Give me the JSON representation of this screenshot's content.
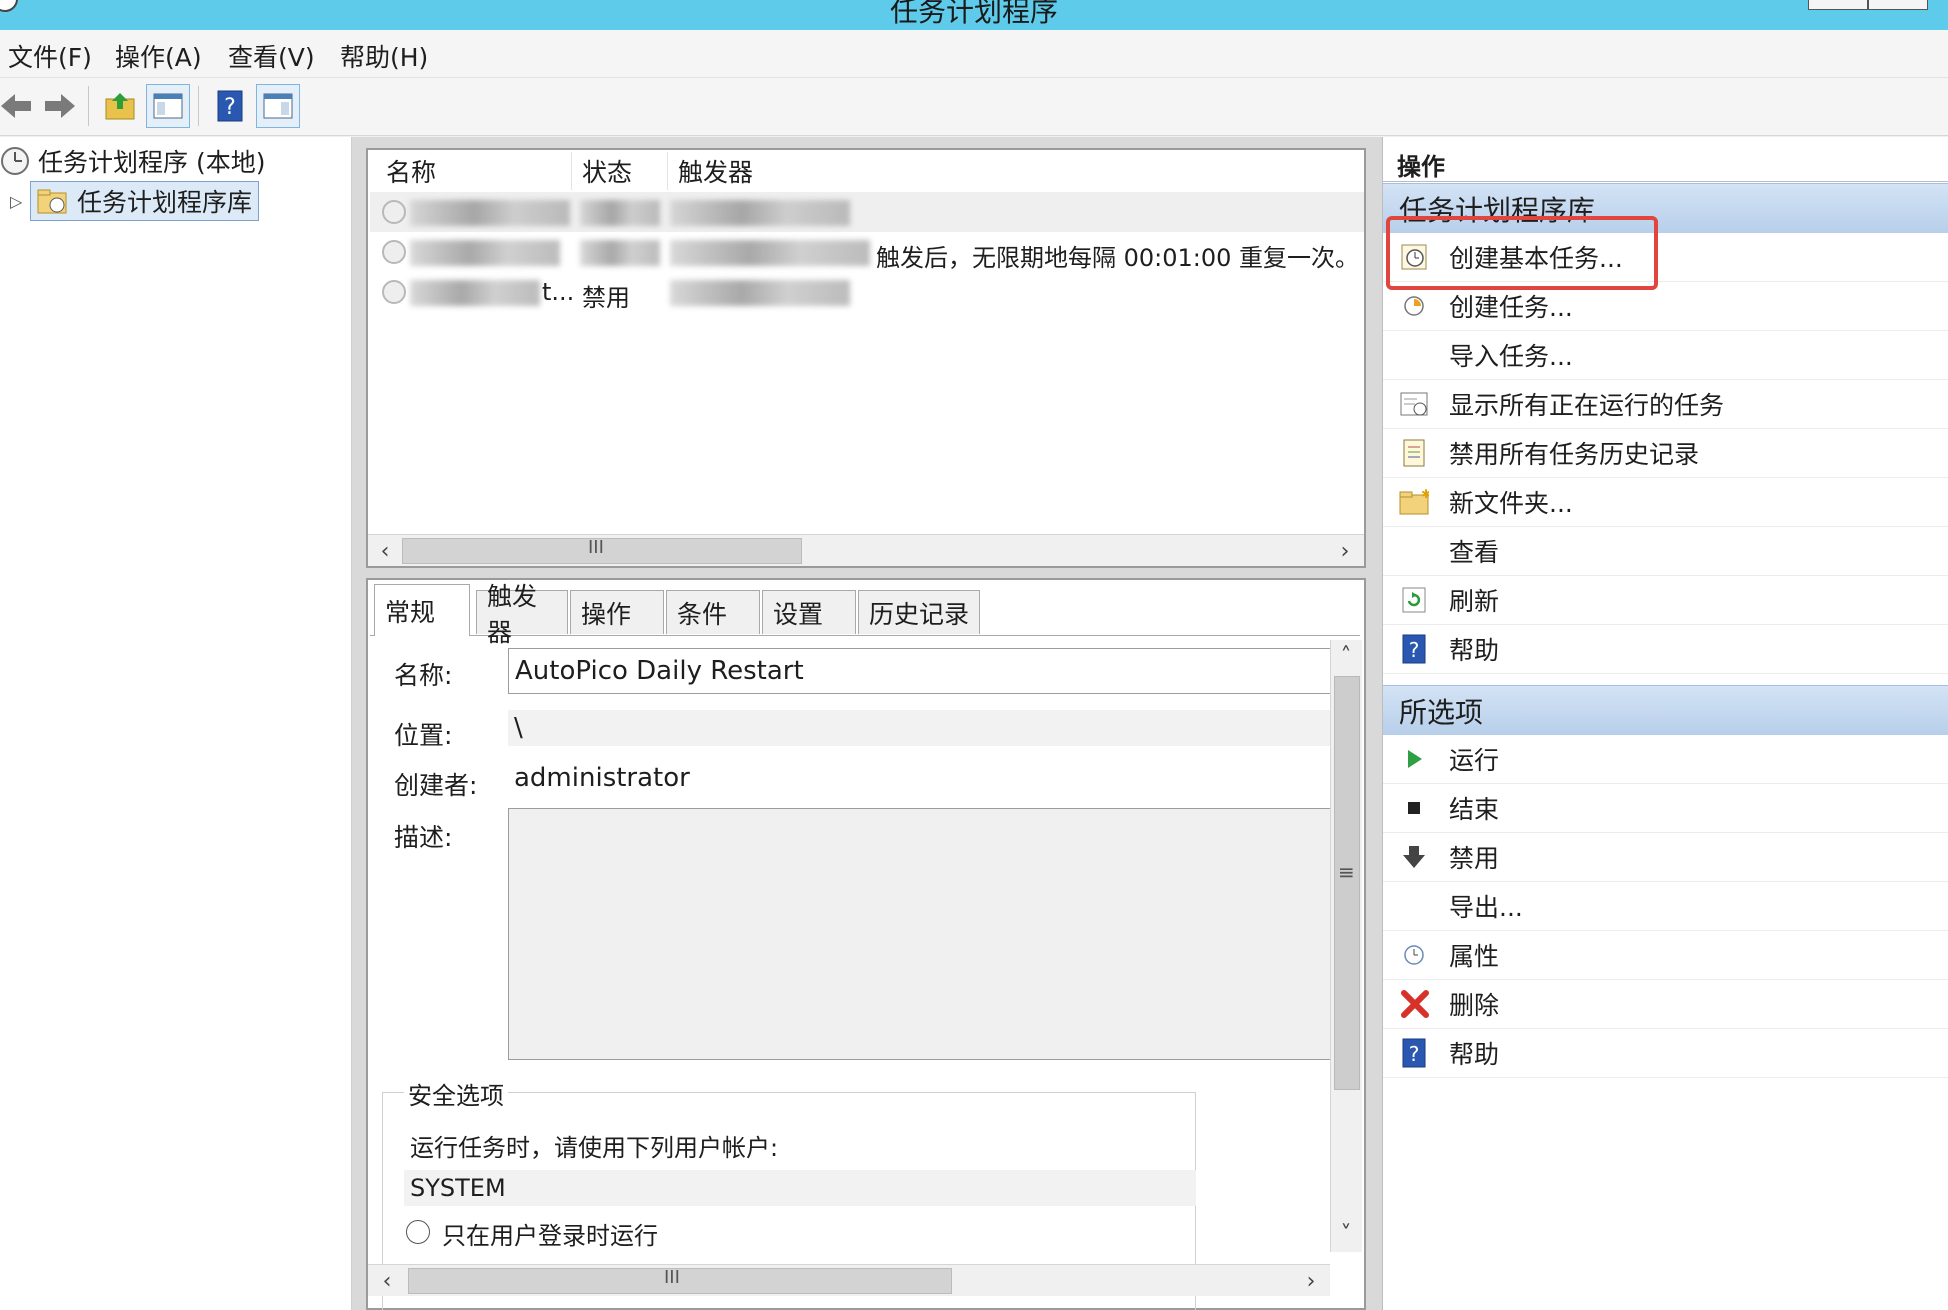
{
  "window": {
    "title": "任务计划程序"
  },
  "menu": [
    "文件(F)",
    "操作(A)",
    "查看(V)",
    "帮助(H)"
  ],
  "tree": {
    "root": "任务计划程序 (本地)",
    "library": "任务计划程序库"
  },
  "task_list": {
    "columns": [
      "名称",
      "状态",
      "触发器"
    ],
    "rows": [
      {
        "name_suffix": "",
        "status": "",
        "trigger_tail": ""
      },
      {
        "name_suffix": "",
        "status": "",
        "trigger_tail": "触发后，无限期地每隔 00:01:00 重复一次。"
      },
      {
        "name_suffix": "t...",
        "status": "禁用",
        "trigger_tail": ""
      }
    ],
    "hscroll_grip": "III"
  },
  "detail": {
    "tabs": [
      "常规",
      "触发器",
      "操作",
      "条件",
      "设置",
      "历史记录"
    ],
    "name_label": "名称:",
    "name_value": "AutoPico Daily Restart",
    "location_label": "位置:",
    "location_value": "\\",
    "author_label": "创建者:",
    "author_value": "administrator",
    "desc_label": "描述:",
    "desc_value": "",
    "security_title": "安全选项",
    "run_as_label": "运行任务时，请使用下列用户帐户:",
    "run_as_value": "SYSTEM",
    "only_logged_on": "只在用户登录时运行",
    "vscroll_grip": "≡",
    "hscroll_grip": "III"
  },
  "actions": {
    "header": "操作",
    "section_library": "任务计划程序库",
    "library_items": [
      "创建基本任务...",
      "创建任务...",
      "导入任务...",
      "显示所有正在运行的任务",
      "禁用所有任务历史记录",
      "新文件夹...",
      "查看",
      "刷新",
      "帮助"
    ],
    "section_selected": "所选项",
    "selected_items": [
      "运行",
      "结束",
      "禁用",
      "导出...",
      "属性",
      "删除",
      "帮助"
    ]
  },
  "colors": {
    "titlebar": "#5ecbea",
    "highlight": "#e0453e",
    "section_bg": "#c6d9ef"
  }
}
